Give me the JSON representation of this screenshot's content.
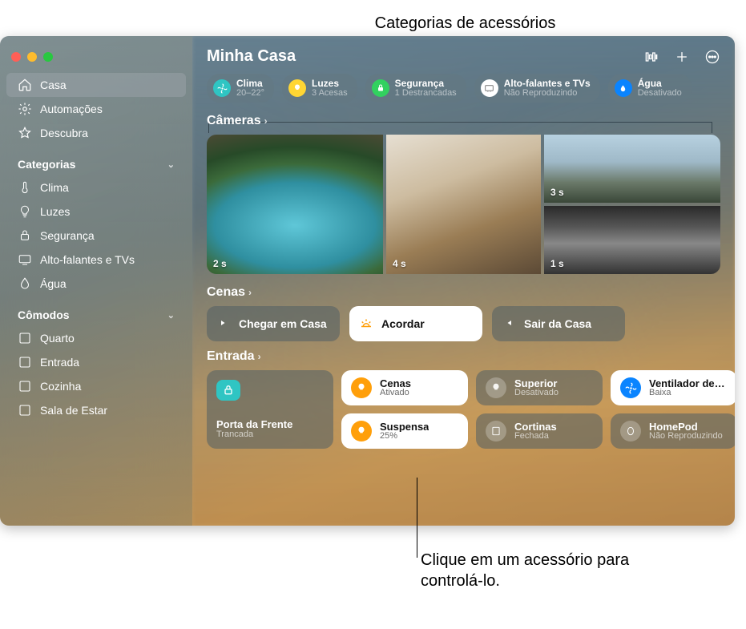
{
  "callouts": {
    "top": "Categorias de acessórios",
    "bottom": "Clique em um acessório para controlá-lo."
  },
  "header": {
    "title": "Minha Casa"
  },
  "sidebar": {
    "items": [
      {
        "label": "Casa"
      },
      {
        "label": "Automações"
      },
      {
        "label": "Descubra"
      }
    ],
    "section_categories_title": "Categorias",
    "categories": [
      {
        "label": "Clima"
      },
      {
        "label": "Luzes"
      },
      {
        "label": "Segurança"
      },
      {
        "label": "Alto-falantes e TVs"
      },
      {
        "label": "Água"
      }
    ],
    "section_rooms_title": "Cômodos",
    "rooms": [
      {
        "label": "Quarto"
      },
      {
        "label": "Entrada"
      },
      {
        "label": "Cozinha"
      },
      {
        "label": "Sala de Estar"
      }
    ]
  },
  "category_pills": [
    {
      "title": "Clima",
      "sub": "20–22°",
      "color": "#2fc5c3",
      "icon": "fan"
    },
    {
      "title": "Luzes",
      "sub": "3 Acesas",
      "color": "#ffd634",
      "icon": "bulb"
    },
    {
      "title": "Segurança",
      "sub": "1 Destrancadas",
      "color": "#32d15f",
      "icon": "lock"
    },
    {
      "title": "Alto-falantes e TVs",
      "sub": "Não Reproduzindo",
      "color": "#ffffff",
      "icon": "tv"
    },
    {
      "title": "Água",
      "sub": "Desativado",
      "color": "#0a84ff",
      "icon": "drop"
    }
  ],
  "sections": {
    "cameras_title": "Câmeras",
    "cameras": [
      {
        "stamp": "2 s"
      },
      {
        "stamp": "3 s"
      },
      {
        "stamp": "1 s"
      },
      {
        "stamp": "4 s"
      }
    ],
    "scenes_title": "Cenas",
    "scenes": [
      {
        "label": "Chegar em Casa",
        "style": "dark",
        "icon": "arrive"
      },
      {
        "label": "Acordar",
        "style": "light",
        "icon": "sunrise"
      },
      {
        "label": "Sair da Casa",
        "style": "dark",
        "icon": "leave"
      }
    ],
    "room_title": "Entrada",
    "tiles": {
      "door": {
        "name": "Porta da Frente",
        "sub": "Trancada"
      },
      "t0": {
        "name": "Cenas",
        "sub": "Ativado"
      },
      "t1": {
        "name": "Superior",
        "sub": "Desativado"
      },
      "t2": {
        "name": "Ventilador de Teto",
        "sub": "Baixa"
      },
      "t3": {
        "name": "Suspensa",
        "sub": "25%"
      },
      "t4": {
        "name": "Cortinas",
        "sub": "Fechada"
      },
      "t5": {
        "name": "HomePod",
        "sub": "Não Reproduzindo"
      }
    }
  }
}
